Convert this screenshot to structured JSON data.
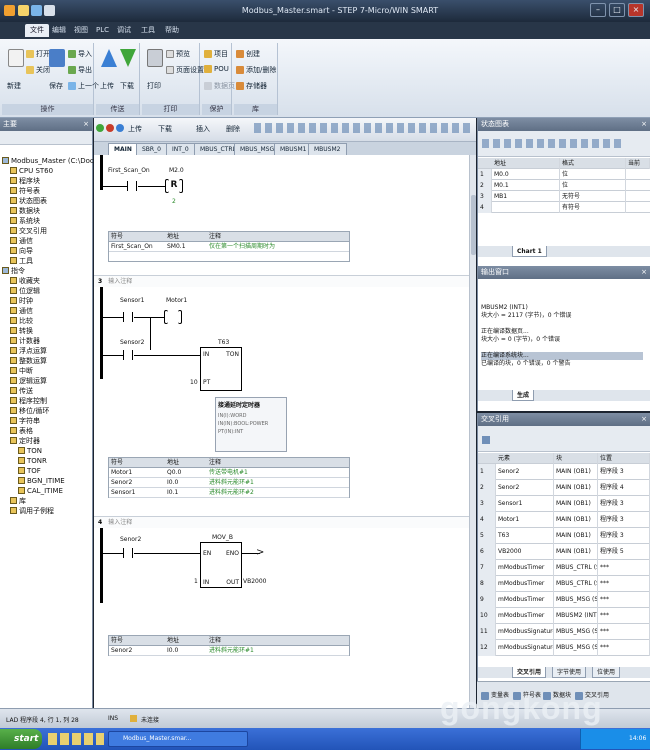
{
  "window": {
    "title": "Modbus_Master.smart - STEP 7-Micro/WIN SMART"
  },
  "menu": [
    "文件",
    "编辑",
    "视图",
    "PLC",
    "调试",
    "工具",
    "帮助"
  ],
  "ribbon": {
    "groups": [
      {
        "label": "操作",
        "items": [
          "新建",
          "打开",
          "关闭",
          "保存",
          "导入",
          "导出",
          "上一个"
        ]
      },
      {
        "label": "传送",
        "items": [
          "上传",
          "下载"
        ]
      },
      {
        "label": "打印",
        "items": [
          "打印",
          "预览",
          "页面设置"
        ]
      },
      {
        "label": "保护",
        "items": [
          "项目",
          "POU",
          "数据页"
        ]
      },
      {
        "label": "库",
        "items": [
          "创建",
          "添加/删除",
          "存储器"
        ]
      }
    ]
  },
  "left_panel": {
    "title": "主要",
    "tree": [
      "Modbus_Master (C:\\Documents a",
      "CPU ST60",
      "程序块",
      "符号表",
      "状态图表",
      "数据块",
      "系统块",
      "交叉引用",
      "通信",
      "向导",
      "工具",
      "指令",
      "收藏夹",
      "位逻辑",
      "时钟",
      "通信",
      "比较",
      "转换",
      "计数器",
      "浮点运算",
      "整数运算",
      "中断",
      "逻辑运算",
      "传送",
      "程序控制",
      "移位/循环",
      "字符串",
      "表格",
      "定时器",
      "TON",
      "TONR",
      "TOF",
      "BGN_ITIME",
      "CAL_ITIME",
      "库",
      "调用子例程"
    ]
  },
  "editor": {
    "toolbar": [
      "上传",
      "下载",
      "插入",
      "删除"
    ],
    "tabs": [
      "MAIN",
      "SBR_0",
      "INT_0",
      "MBUS_CTRL",
      "MBUS_MSG",
      "MBUSM1",
      "MBUSM2"
    ],
    "networks": [
      {
        "contact": "First_Scan_On",
        "coil_addr": "M2.0",
        "coil_type": "R",
        "coil_n": "2",
        "symbols": {
          "headers": [
            "符号",
            "地址",
            "注释"
          ],
          "rows": [
            [
              "First_Scan_On",
              "SM0.1",
              "仅在第一个扫描周期时为"
            ]
          ]
        }
      },
      {
        "number": "3",
        "comment": "输入注释",
        "c1": "Sensor1",
        "coil": "Motor1",
        "c2": "Sensor2",
        "timer": "T63",
        "tin": "IN",
        "ton": "TON",
        "pt_val": "10",
        "pt": "PT",
        "tooltip": [
          "接通延时定时器",
          "IN(I):WORD",
          "IN(IN):BOOL:POWER",
          "PT(IN):INT"
        ],
        "symbols": {
          "headers": [
            "符号",
            "地址",
            "注释"
          ],
          "rows": [
            [
              "Motor1",
              "Q0.0",
              "传送带电机#1"
            ],
            [
              "Senor2",
              "I0.0",
              "进料斜元能环#1"
            ],
            [
              "Sensor1",
              "I0.1",
              "进料斜元能环#2"
            ]
          ]
        }
      },
      {
        "number": "4",
        "comment": "输入注释",
        "contact": "Senor2",
        "box": "MOV_B",
        "en": "EN",
        "eno": "ENO",
        "in_val": "1",
        "in": "IN",
        "out": "OUT",
        "out_val": "VB2000",
        "symbols": {
          "headers": [
            "符号",
            "地址",
            "注释"
          ],
          "rows": [
            [
              "Senor2",
              "I0.0",
              "进料斜元能环#1"
            ]
          ]
        }
      }
    ]
  },
  "status_chart": {
    "title": "状态图表",
    "headers": [
      "地址",
      "格式",
      "当前"
    ],
    "rows": [
      [
        "M0.0",
        "位"
      ],
      [
        "M0.1",
        "位"
      ],
      [
        "MB1",
        "无符号"
      ],
      [
        "",
        "有符号"
      ]
    ],
    "sheet_tab": "Chart 1"
  },
  "output": {
    "title": "输出窗口",
    "lines": [
      "MBUSM2 (INT1)",
      "块大小 = 2117 (字节)，0 个错误",
      "",
      "正在编译数据页...",
      "块大小 = 0 (字节)，0 个错误",
      "",
      "正在编译系统块...",
      "已编译的块，0 个错误，0 个警告"
    ],
    "tab": "生成"
  },
  "crossref": {
    "title": "交叉引用",
    "headers": [
      "元素",
      "块",
      "位置"
    ],
    "rows": [
      [
        "1",
        "Senor2",
        "MAIN (OB1)",
        "程序段 3"
      ],
      [
        "2",
        "Senor2",
        "MAIN (OB1)",
        "程序段 4"
      ],
      [
        "3",
        "Sensor1",
        "MAIN (OB1)",
        "程序段 3"
      ],
      [
        "4",
        "Motor1",
        "MAIN (OB1)",
        "程序段 3"
      ],
      [
        "5",
        "T63",
        "MAIN (OB1)",
        "程序段 3"
      ],
      [
        "6",
        "VB2000",
        "MAIN (OB1)",
        "程序段 5"
      ],
      [
        "7",
        "mModbusTimer",
        "MBUS_CTRL (S...",
        "***"
      ],
      [
        "8",
        "mModbusTimer",
        "MBUS_CTRL (S...",
        "***"
      ],
      [
        "9",
        "mModbusTimer",
        "MBUS_MSG (SB...",
        "***"
      ],
      [
        "10",
        "mModbusTimer",
        "MBUSM2 (INT1)",
        "***"
      ],
      [
        "11",
        "mModbusSignature1",
        "MBUS_MSG (SB...",
        "***"
      ],
      [
        "12",
        "mModbusSignature1",
        "MBUS_MSG (SB...",
        "***"
      ]
    ],
    "tabs": [
      "交叉引用",
      "字节使用",
      "位使用"
    ]
  },
  "bottom_tabs": [
    "变量表",
    "符号表",
    "数据块",
    "交叉引用"
  ],
  "status": {
    "pos": "LAD 程序段 4, 行 1, 列 28",
    "mode": "INS",
    "conn": "未连接"
  },
  "taskbar": {
    "start": "start",
    "items": [
      "Modbus_Master.smar..."
    ],
    "clock": "14:06"
  },
  "watermark": "gongkong"
}
